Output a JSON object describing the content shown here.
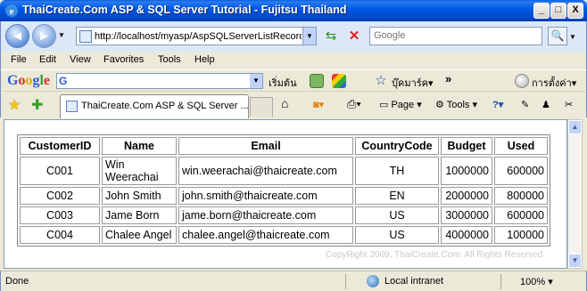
{
  "window": {
    "title": "ThaiCreate.Com ASP & SQL Server Tutorial - Fujitsu Thailand",
    "min_glyph": "_",
    "max_glyph": "□",
    "close_glyph": "X"
  },
  "navbar": {
    "back_glyph": "◄",
    "forward_glyph": "►",
    "address_url": "http://localhost/myasp/AspSQLServerListRecord",
    "search_placeholder": "Google",
    "search_go_glyph": "🔍"
  },
  "menu": {
    "items": [
      {
        "label": "File"
      },
      {
        "label": "Edit"
      },
      {
        "label": "View"
      },
      {
        "label": "Favorites"
      },
      {
        "label": "Tools"
      },
      {
        "label": "Help"
      }
    ]
  },
  "googlebar": {
    "logo": {
      "c1": "G",
      "c2": "o",
      "c3": "o",
      "c4": "g",
      "c5": "l",
      "c6": "e"
    },
    "mini_g": "G",
    "start_label": "เริ่มต้น",
    "bookmarks_label": "บุ๊คมาร์ค▾",
    "more_glyph": "»",
    "settings_label": "การตั้งค่า▾"
  },
  "tabs": {
    "active_label": "ThaiCreate.Com ASP & SQL Server ...",
    "page_label": "Page ▾",
    "tools_label": "Tools ▾"
  },
  "table": {
    "headers": [
      "CustomerID",
      "Name",
      "Email",
      "CountryCode",
      "Budget",
      "Used"
    ],
    "rows": [
      [
        "C001",
        "Win Weerachai",
        "win.weerachai@thaicreate.com",
        "TH",
        "1000000",
        "600000"
      ],
      [
        "C002",
        "John Smith",
        "john.smith@thaicreate.com",
        "EN",
        "2000000",
        "800000"
      ],
      [
        "C003",
        "Jame Born",
        "jame.born@thaicreate.com",
        "US",
        "3000000",
        "600000"
      ],
      [
        "C004",
        "Chalee Angel",
        "chalee.angel@thaicreate.com",
        "US",
        "4000000",
        "100000"
      ]
    ]
  },
  "watermark": "CopyRight 2009, ThaiCreate.Com. All Rights Reserved",
  "status": {
    "text": "Done",
    "zone": "Local intranet",
    "zoom": "100%  ▾"
  }
}
